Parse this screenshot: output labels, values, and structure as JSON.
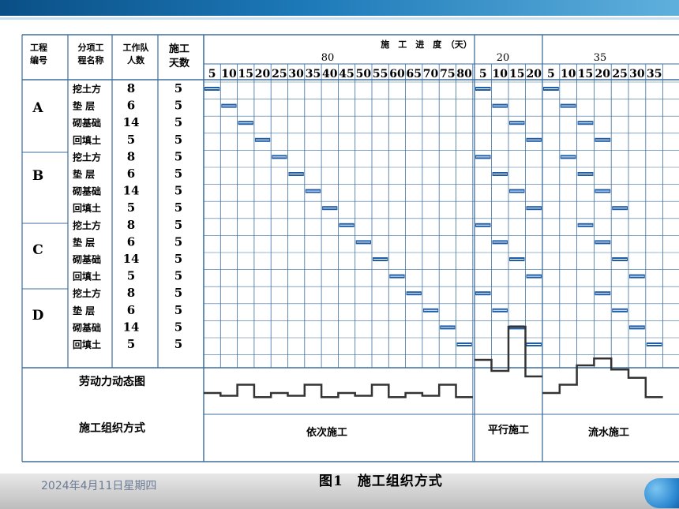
{
  "header": {
    "col_code": "工程编号",
    "col_code_l1": "工程",
    "col_code_l2": "编号",
    "col_name_l1": "分项工",
    "col_name_l2": "程名称",
    "col_team_l1": "工作队",
    "col_team_l2": "人数",
    "col_days_l1": "施工",
    "col_days_l2": "天数",
    "progress_title": "施　工　进　度　（天）",
    "section_totals": [
      "80",
      "20",
      "35"
    ],
    "ticks_seq": [
      "5",
      "10",
      "15",
      "20",
      "25",
      "30",
      "35",
      "40",
      "45",
      "50",
      "55",
      "60",
      "65",
      "70",
      "75",
      "80"
    ],
    "ticks_par": [
      "5",
      "10",
      "15",
      "20"
    ],
    "ticks_flow": [
      "5",
      "10",
      "15",
      "20",
      "25",
      "30",
      "35"
    ]
  },
  "projects": [
    {
      "code": "A",
      "tasks": [
        {
          "name": "挖土方",
          "team": "8",
          "days": "5"
        },
        {
          "name": "垫 层",
          "team": "6",
          "days": "5"
        },
        {
          "name": "砌基础",
          "team": "14",
          "days": "5"
        },
        {
          "name": "回填土",
          "team": "5",
          "days": "5"
        }
      ]
    },
    {
      "code": "B",
      "tasks": [
        {
          "name": "挖土方",
          "team": "8",
          "days": "5"
        },
        {
          "name": "垫 层",
          "team": "6",
          "days": "5"
        },
        {
          "name": "砌基础",
          "team": "14",
          "days": "5"
        },
        {
          "name": "回填土",
          "team": "5",
          "days": "5"
        }
      ]
    },
    {
      "code": "C",
      "tasks": [
        {
          "name": "挖土方",
          "team": "8",
          "days": "5"
        },
        {
          "name": "垫 层",
          "team": "6",
          "days": "5"
        },
        {
          "name": "砌基础",
          "team": "14",
          "days": "5"
        },
        {
          "name": "回填土",
          "team": "5",
          "days": "5"
        }
      ]
    },
    {
      "code": "D",
      "tasks": [
        {
          "name": "挖土方",
          "team": "8",
          "days": "5"
        },
        {
          "name": "垫 层",
          "team": "6",
          "days": "5"
        },
        {
          "name": "砌基础",
          "team": "14",
          "days": "5"
        },
        {
          "name": "回填土",
          "team": "5",
          "days": "5"
        }
      ]
    }
  ],
  "schedule": {
    "sequential_starts": [
      0,
      5,
      10,
      15,
      20,
      25,
      30,
      35,
      40,
      45,
      50,
      55,
      60,
      65,
      70,
      75
    ],
    "parallel_starts": [
      0,
      5,
      10,
      15
    ],
    "flow_starts": [
      0,
      5,
      10,
      15,
      5,
      10,
      15,
      20,
      10,
      15,
      20,
      25,
      15,
      20,
      25,
      30
    ]
  },
  "labor_label": "劳动力动态图",
  "method_label": "施工组织方式",
  "methods": [
    "依次施工",
    "平行施工",
    "流水施工"
  ],
  "figure_caption": "图1　施工组织方式",
  "date": "2024年4月11日星期四",
  "colors": {
    "bar": "#1f5da8",
    "grid": "#3d6f9e",
    "banner": "#1d79b8"
  }
}
